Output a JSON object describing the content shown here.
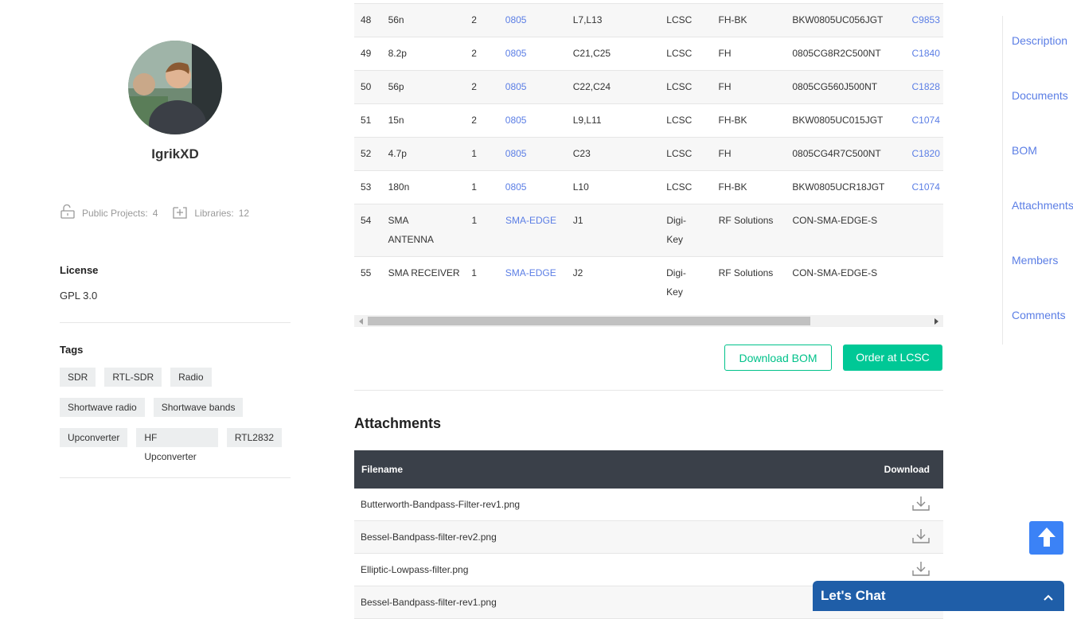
{
  "profile": {
    "username": "IgrikXD",
    "public_projects_label": "Public Projects:",
    "public_projects_count": "4",
    "libraries_label": "Libraries:",
    "libraries_count": "12"
  },
  "license": {
    "title": "License",
    "value": "GPL 3.0"
  },
  "tags": {
    "title": "Tags",
    "rows": [
      [
        "SDR",
        "RTL-SDR",
        "Radio"
      ],
      [
        "Shortwave radio",
        "Shortwave bands"
      ],
      [
        "Upconverter",
        "HF Upconverter",
        "RTL2832"
      ]
    ]
  },
  "bom": {
    "rows": [
      {
        "no": "48",
        "value": "56n",
        "qty": "2",
        "package": "0805",
        "designator": "L7,L13",
        "supplier": "LCSC",
        "manufacturer": "FH-BK",
        "mpn": "BKW0805UC056JGT",
        "supplier_part": "C9853"
      },
      {
        "no": "49",
        "value": "8.2p",
        "qty": "2",
        "package": "0805",
        "designator": "C21,C25",
        "supplier": "LCSC",
        "manufacturer": "FH",
        "mpn": "0805CG8R2C500NT",
        "supplier_part": "C1840"
      },
      {
        "no": "50",
        "value": "56p",
        "qty": "2",
        "package": "0805",
        "designator": "C22,C24",
        "supplier": "LCSC",
        "manufacturer": "FH",
        "mpn": "0805CG560J500NT",
        "supplier_part": "C1828"
      },
      {
        "no": "51",
        "value": "15n",
        "qty": "2",
        "package": "0805",
        "designator": "L9,L11",
        "supplier": "LCSC",
        "manufacturer": "FH-BK",
        "mpn": "BKW0805UC015JGT",
        "supplier_part": "C1074"
      },
      {
        "no": "52",
        "value": "4.7p",
        "qty": "1",
        "package": "0805",
        "designator": "C23",
        "supplier": "LCSC",
        "manufacturer": "FH",
        "mpn": "0805CG4R7C500NT",
        "supplier_part": "C1820"
      },
      {
        "no": "53",
        "value": "180n",
        "qty": "1",
        "package": "0805",
        "designator": "L10",
        "supplier": "LCSC",
        "manufacturer": "FH-BK",
        "mpn": "BKW0805UCR18JGT",
        "supplier_part": "C1074"
      },
      {
        "no": "54",
        "value": "SMA ANTENNA",
        "qty": "1",
        "package": "SMA-EDGE",
        "designator": "J1",
        "supplier": "Digi-Key",
        "manufacturer": "RF Solutions",
        "mpn": "CON-SMA-EDGE-S",
        "supplier_part": ""
      },
      {
        "no": "55",
        "value": "SMA RECEIVER",
        "qty": "1",
        "package": "SMA-EDGE",
        "designator": "J2",
        "supplier": "Digi-Key",
        "manufacturer": "RF Solutions",
        "mpn": "CON-SMA-EDGE-S",
        "supplier_part": ""
      }
    ],
    "download_label": "Download BOM",
    "order_label": "Order at LCSC"
  },
  "attachments": {
    "title": "Attachments",
    "col_filename": "Filename",
    "col_download": "Download",
    "files": [
      "Butterworth-Bandpass-Filter-rev1.png",
      "Bessel-Bandpass-filter-rev2.png",
      "Elliptic-Lowpass-filter.png",
      "Bessel-Bandpass-filter-rev1.png"
    ]
  },
  "nav": [
    "Description",
    "Documents",
    "BOM",
    "Attachments",
    "Members",
    "Comments"
  ],
  "chat": {
    "label": "Let's Chat"
  },
  "colors": {
    "accent": "#00c896",
    "link": "#5b7ee5",
    "header": "#3a4049",
    "chat": "#1f5ea8",
    "up": "#3b82f6"
  },
  "icons": [
    "unlock-icon",
    "add-library-icon",
    "download-icon",
    "arrow-up-icon",
    "chevron-up-icon"
  ]
}
